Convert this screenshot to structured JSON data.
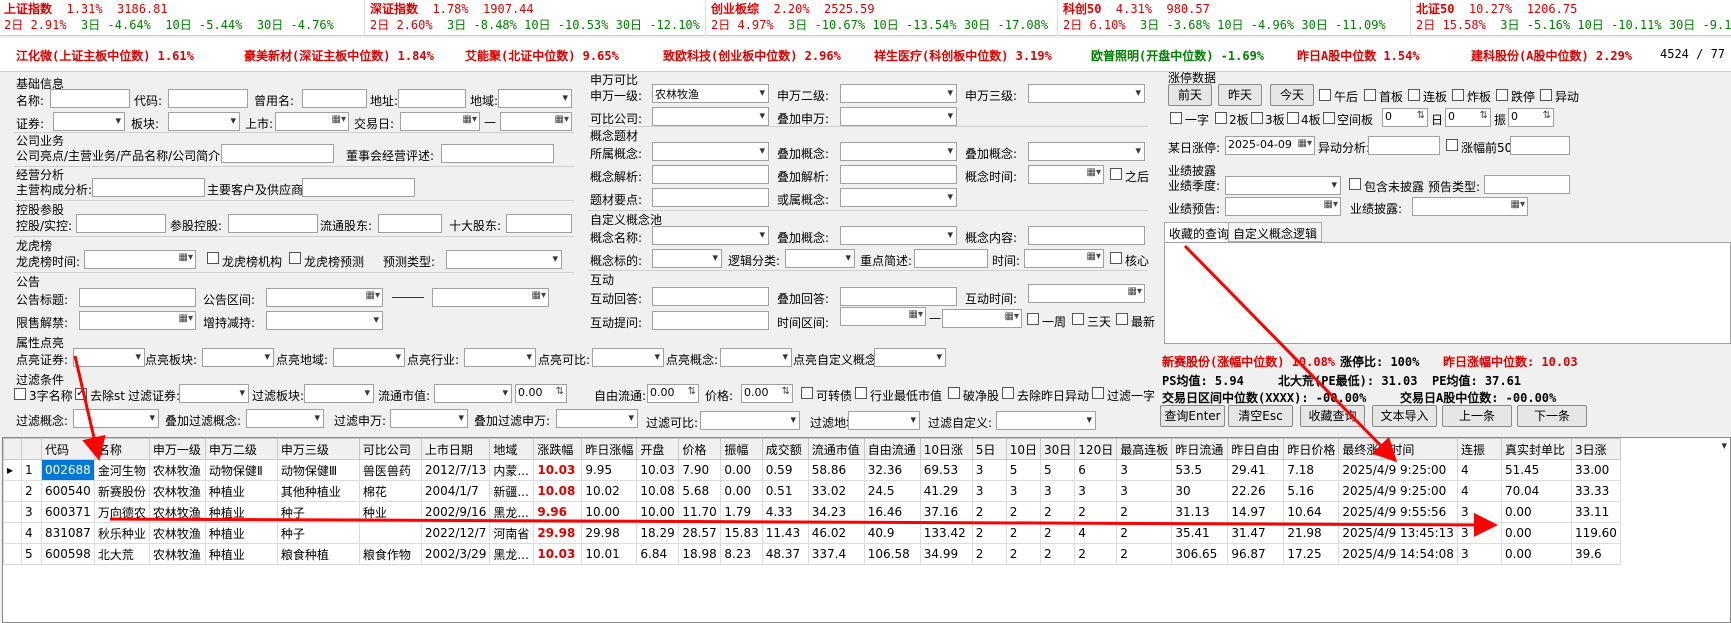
{
  "tickers": [
    {
      "name": "上证指数",
      "pct": "1.31%",
      "value": "3186.81",
      "d2": "2.91%",
      "d3": "-4.64%",
      "d10": "-5.44%",
      "d30": "-4.76%"
    },
    {
      "name": "深证指数",
      "pct": "1.78%",
      "value": "1907.44",
      "d2": "2.60%",
      "d3": "-8.48%",
      "d10": "-10.53%",
      "d30": "-12.10%"
    },
    {
      "name": "创业板综",
      "pct": "2.20%",
      "value": "2525.59",
      "d2": "4.97%",
      "d3": "-10.67%",
      "d10": "-13.54%",
      "d30": "-17.08%"
    },
    {
      "name": "科创50",
      "pct": "4.31%",
      "value": "980.57",
      "d2": "6.10%",
      "d3": "-3.68%",
      "d10": "-4.96%",
      "d30": "-11.09%"
    },
    {
      "name": "北证50",
      "pct": "10.27%",
      "value": "1206.75",
      "d2": "15.58%",
      "d3": "-5.16%",
      "d10": "-10.11%",
      "d30": "-9.1"
    }
  ],
  "ticker_labels": {
    "d2": "2日",
    "d3": "3日",
    "d10": "10日",
    "d30": "30日"
  },
  "mid_items": [
    "江化微(上证主板中位数) 1.61%",
    "豪美新材(深证主板中位数) 1.84%",
    "艾能聚(北证中位数) 9.65%",
    "致欧科技(创业板中位数) 2.96%",
    "祥生医疗(科创板中位数) 3.19%",
    "欧普照明(开盘中位数) -1.69%",
    "昨日A股中位数 1.54%",
    "建科股份(A股中位数) 2.29%",
    "4524 / 77"
  ],
  "basic": {
    "title": "基础信息",
    "name": "名称:",
    "code": "代码:",
    "former": "曾用名:",
    "address": "地址:",
    "region": "地域:",
    "security": "证券:",
    "sector": "板块:",
    "listed": "上市:",
    "trade_day": "交易日:",
    "dash": "—"
  },
  "company": {
    "title": "公司业务",
    "highlights": "公司亮点/主营业务/产品名称/公司简介:",
    "board": "董事会经营评述:"
  },
  "operation": {
    "title": "经营分析",
    "composition": "主营构成分析:",
    "customers": "主要客户及供应商:"
  },
  "control": {
    "title": "控股参股",
    "holder": "控股/实控:",
    "stake": "参股控股:",
    "float": "流通股东:",
    "top10": "十大股东:"
  },
  "dragon": {
    "title": "龙虎榜",
    "time": "龙虎榜时间:",
    "inst": "龙虎榜机构",
    "predict": "龙虎榜预测",
    "type": "预测类型:"
  },
  "notice": {
    "title": "公告",
    "subject": "公告标题:",
    "range": "公告区间:",
    "unlock": "限售解禁:",
    "shareholding": "增持减持:"
  },
  "sw": {
    "title": "申万可比",
    "l1": "申万一级:",
    "l1_val": "农林牧渔",
    "l2": "申万二级:",
    "l3": "申万三级:",
    "comparable": "可比公司:",
    "add": "叠加申万:"
  },
  "concept": {
    "title": "概念题材",
    "owned": "所属概念:",
    "add1": "叠加概念:",
    "add2": "叠加概念:",
    "analysis": "概念解析:",
    "add_analysis": "叠加解析:",
    "time": "概念时间:",
    "after": "之后",
    "points": "题材要点:",
    "or": "或属概念:"
  },
  "custom": {
    "title": "自定义概念池",
    "name": "概念名称:",
    "add": "叠加概念:",
    "content": "概念内容:",
    "target": "概念标的:",
    "logic": "逻辑分类:",
    "brief": "重点简述:",
    "time": "时间:",
    "core": "核心"
  },
  "interact": {
    "title": "互动",
    "answer": "互动回答:",
    "add_answer": "叠加回答:",
    "time": "互动时间:",
    "question": "互动提问:",
    "range": "时间区间:",
    "week": "一周",
    "three": "三天",
    "latest": "最新"
  },
  "highlight": {
    "title": "属性点亮",
    "sec": "点亮证券:",
    "sector": "点亮板块:",
    "region": "点亮地域:",
    "industry": "点亮行业:",
    "comparable": "点亮可比:",
    "concept": "点亮概念:",
    "custom": "点亮自定义概念:"
  },
  "filter": {
    "title": "过滤条件",
    "three_char": "3字名称",
    "remove_st": "去除st",
    "sec": "过滤证券:",
    "sector": "过滤板块:",
    "mcap": "流通市值:",
    "mcap_val": "0.00",
    "free": "自由流通:",
    "free_val": "0.00",
    "price": "价格:",
    "price_val": "0.00",
    "convertible": "可转债",
    "lowest": "行业最低市值",
    "break_net": "破净股",
    "remove_abn": "去除昨日异动",
    "filter_one": "过滤一字",
    "concept": "过滤概念:",
    "add_concept": "叠加过滤概念:",
    "sw": "过滤申万:",
    "add_sw": "叠加过滤申万:",
    "comparable": "过滤可比:",
    "region": "过滤地域:",
    "custom": "过滤自定义:"
  },
  "limit": {
    "title": "涨停数据",
    "before": "前天",
    "yesterday": "昨天",
    "today": "今天",
    "afternoon": "午后",
    "first": "首板",
    "consecutive": "连板",
    "broken": "炸板",
    "fall": "跌停",
    "abn": "异动",
    "yizi": "一字",
    "b2": "2板",
    "b3": "3板",
    "b4": "4板",
    "empty_b": "空间板",
    "zero1": "0",
    "day": "日",
    "zero2": "0",
    "zhen": "振",
    "zero3": "0",
    "date_lbl": "某日涨停:",
    "date_val": "2025-04-09",
    "abn_analysis": "异动分析:",
    "top50": "涨幅前50"
  },
  "perf": {
    "title": "业绩披露",
    "season": "业绩季度:",
    "include": "包含未披露",
    "forecast_type": "预告类型:",
    "forecast": "业绩预告:",
    "disclose": "业绩披露:"
  },
  "tabs": {
    "fav": "收藏的查询",
    "custom": "自定义概念逻辑"
  },
  "stats": {
    "s1": "新赛股份(涨幅中位数) 10.08%",
    "s2": "涨停比: 100%",
    "s3": "昨日涨幅中位数: 10.03",
    "s4": "PS均值: 5.94",
    "s5": "北大荒(PE最低): 31.03",
    "s6": "PE均值: 37.61",
    "s7": "交易日区间中位数(XXXX): -00.00%",
    "s8": "交易日A股中位数: -00.00%"
  },
  "actions": {
    "query": "查询Enter",
    "clear": "清空Esc",
    "fav": "收藏查询",
    "import": "文本导入",
    "prev": "上一条",
    "next": "下一条"
  },
  "table": {
    "headers": [
      "",
      "",
      "代码",
      "名称",
      "申万一级",
      "申万二级",
      "申万三级",
      "可比公司",
      "上市日期",
      "地域",
      "涨跌幅",
      "昨日涨幅",
      "开盘",
      "价格",
      "振幅",
      "成交额",
      "流通市值",
      "自由流通",
      "10日涨",
      "5日",
      "10日",
      "30日",
      "120日",
      "最高连板",
      "昨日流通",
      "昨日自由",
      "昨日价格",
      "最终涨停时间",
      "连振",
      "真实封单比",
      "3日涨"
    ],
    "rows": [
      [
        "▸",
        "1",
        "002688",
        "金河生物",
        "农林牧渔",
        "动物保健Ⅱ",
        "动物保健Ⅲ",
        "兽医兽药",
        "2012/7/13",
        "内蒙...",
        "10.03",
        "9.95",
        "10.03",
        "7.90",
        "0.00",
        "0.59",
        "58.86",
        "32.36",
        "69.53",
        "3",
        "5",
        "5",
        "6",
        "3",
        "53.5",
        "29.41",
        "7.18",
        "2025/4/9 9:25:00",
        "4",
        "51.45",
        "33.00"
      ],
      [
        "",
        "2",
        "600540",
        "新赛股份",
        "农林牧渔",
        "种植业",
        "其他种植业",
        "棉花",
        "2004/1/7",
        "新疆...",
        "10.08",
        "10.02",
        "10.08",
        "5.68",
        "0.00",
        "0.51",
        "33.02",
        "24.5",
        "41.29",
        "3",
        "3",
        "3",
        "3",
        "3",
        "30",
        "22.26",
        "5.16",
        "2025/4/9 9:25:00",
        "4",
        "70.04",
        "33.33"
      ],
      [
        "",
        "3",
        "600371",
        "万向德农",
        "农林牧渔",
        "种植业",
        "种子",
        "种业",
        "2002/9/16",
        "黑龙...",
        "9.96",
        "10.00",
        "10.00",
        "11.70",
        "1.79",
        "4.33",
        "34.23",
        "16.46",
        "37.16",
        "2",
        "2",
        "2",
        "2",
        "2",
        "31.13",
        "14.97",
        "10.64",
        "2025/4/9 9:55:56",
        "3",
        "0.00",
        "33.11"
      ],
      [
        "",
        "4",
        "831087",
        "秋乐种业",
        "农林牧渔",
        "种植业",
        "种子",
        "",
        "2022/12/7",
        "河南省",
        "29.98",
        "29.98",
        "18.29",
        "28.57",
        "15.83",
        "11.43",
        "46.02",
        "40.9",
        "133.42",
        "2",
        "2",
        "2",
        "4",
        "2",
        "35.41",
        "31.47",
        "21.98",
        "2025/4/9 13:45:13",
        "3",
        "0.00",
        "119.60"
      ],
      [
        "",
        "5",
        "600598",
        "北大荒",
        "农林牧渔",
        "种植业",
        "粮食种植",
        "粮食作物",
        "2002/3/29",
        "黑龙...",
        "10.03",
        "10.01",
        "6.84",
        "18.98",
        "8.23",
        "48.37",
        "337.4",
        "106.58",
        "34.99",
        "2",
        "2",
        "2",
        "2",
        "2",
        "306.65",
        "96.87",
        "17.25",
        "2025/4/9 14:54:08",
        "3",
        "0.00",
        "39.6"
      ]
    ]
  }
}
